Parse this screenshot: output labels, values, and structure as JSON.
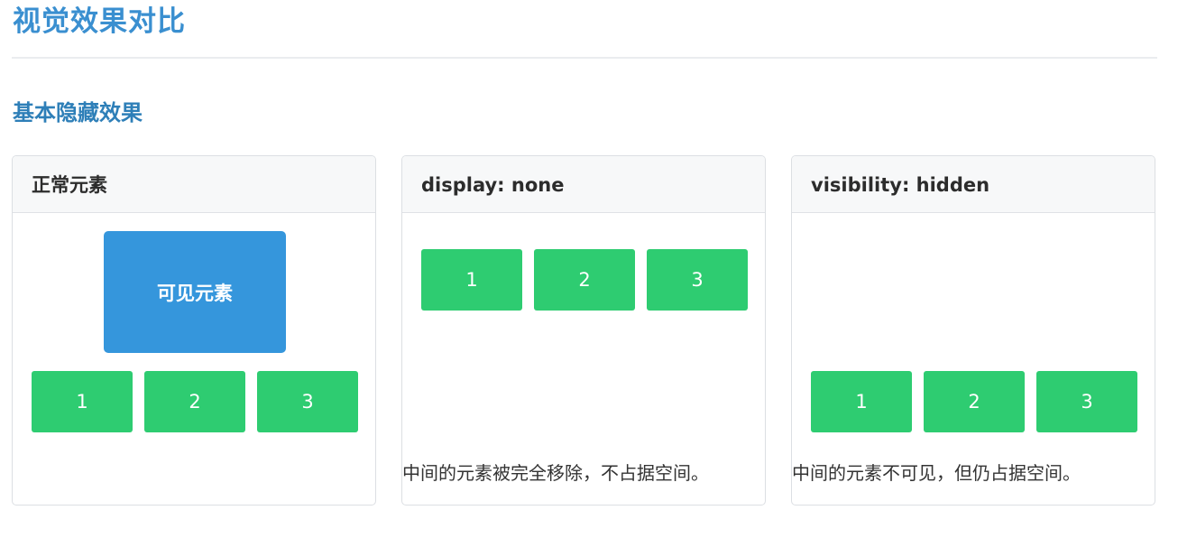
{
  "page": {
    "title": "视觉效果对比"
  },
  "section": {
    "title": "基本隐藏效果"
  },
  "cards": [
    {
      "header": "正常元素",
      "visible_box_label": "可见元素",
      "boxes": [
        "1",
        "2",
        "3"
      ],
      "note": ""
    },
    {
      "header": "display: none",
      "boxes": [
        "1",
        "2",
        "3"
      ],
      "note": "中间的元素被完全移除，不占据空间。"
    },
    {
      "header": "visibility: hidden",
      "boxes": [
        "1",
        "2",
        "3"
      ],
      "note": "中间的元素不可见，但仍占据空间。"
    }
  ],
  "colors": {
    "title": "#3a8fd0",
    "section_title": "#2e7fb8",
    "visible_box": "#3596dc",
    "green_box": "#2ecc71",
    "card_header_bg": "#f7f8f9",
    "border": "#dcdfe3"
  }
}
